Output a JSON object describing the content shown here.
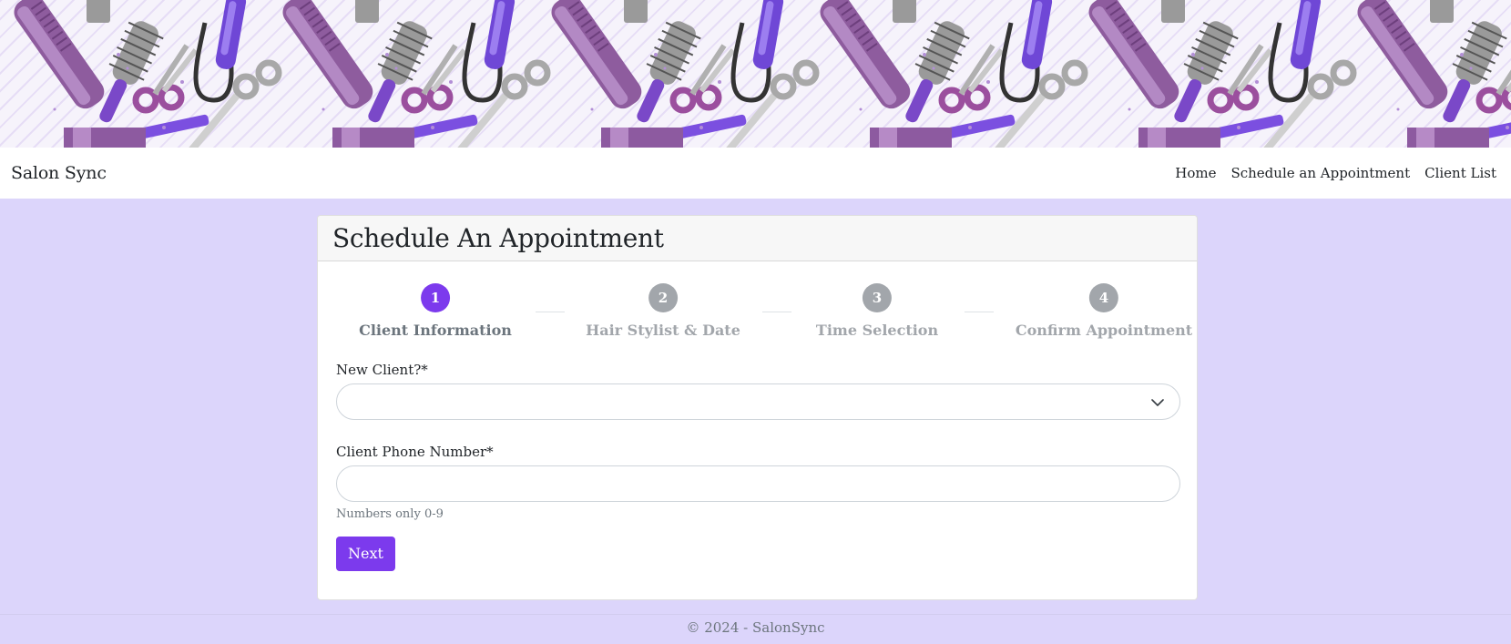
{
  "banner": {
    "alt": "Hair salon tools pattern"
  },
  "navbar": {
    "brand": "Salon Sync",
    "links": [
      "Home",
      "Schedule an Appointment",
      "Client List"
    ]
  },
  "card": {
    "title": "Schedule An Appointment",
    "steps": [
      {
        "number": "1",
        "label": "Client Information",
        "active": true
      },
      {
        "number": "2",
        "label": "Hair Stylist & Date",
        "active": false
      },
      {
        "number": "3",
        "label": "Time Selection",
        "active": false
      },
      {
        "number": "4",
        "label": "Confirm Appointment",
        "active": false
      }
    ],
    "fields": {
      "new_client_label": "New Client?",
      "new_client_value": "",
      "phone_label": "Client Phone Number",
      "phone_value": "",
      "phone_hint": "Numbers only 0-9",
      "required_mark": "*"
    },
    "next_button": "Next"
  },
  "footer": {
    "text": "© 2024 - SalonSync"
  },
  "colors": {
    "accent": "#7c3aed",
    "page_bg": "#dcd5fb",
    "inactive_step": "#a2a6ab"
  }
}
